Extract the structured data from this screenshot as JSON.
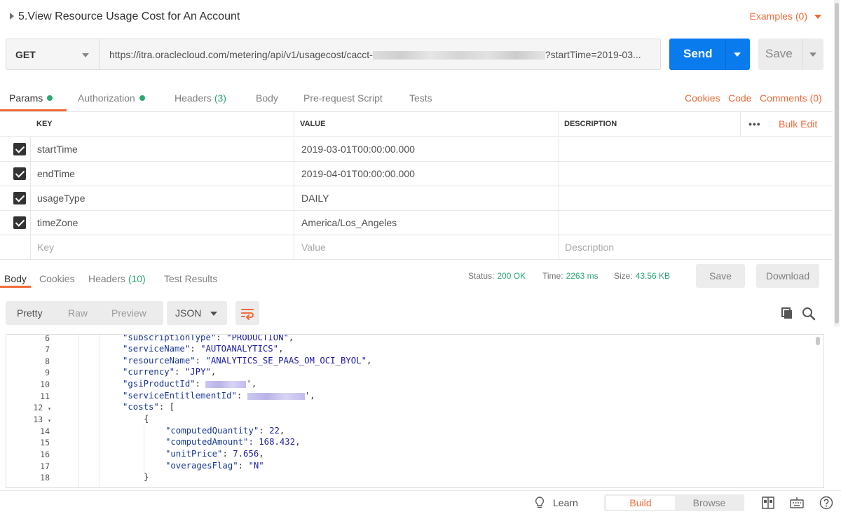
{
  "request": {
    "title": "5.View Resource Usage Cost for An Account",
    "examples_label": "Examples (0)",
    "method": "GET",
    "url_prefix": "https://itra.oraclecloud.com/metering/api/v1/usagecost/cacct-",
    "url_suffix": "?startTime=2019-03...",
    "send_label": "Send",
    "save_label": "Save"
  },
  "request_tabs": {
    "params": "Params",
    "authorization": "Authorization",
    "headers": "Headers",
    "headers_count": "(3)",
    "body": "Body",
    "pre_request": "Pre-request Script",
    "tests": "Tests",
    "cookies": "Cookies",
    "code": "Code",
    "comments": "Comments (0)"
  },
  "params_table": {
    "headers": [
      "KEY",
      "VALUE",
      "DESCRIPTION"
    ],
    "more": "•••",
    "bulk_edit": "Bulk Edit",
    "rows": [
      {
        "key": "startTime",
        "value": "2019-03-01T00:00:00.000",
        "description": ""
      },
      {
        "key": "endTime",
        "value": "2019-04-01T00:00:00.000",
        "description": ""
      },
      {
        "key": "usageType",
        "value": "DAILY",
        "description": ""
      },
      {
        "key": "timeZone",
        "value": "America/Los_Angeles",
        "description": ""
      }
    ],
    "placeholder": {
      "key": "Key",
      "value": "Value",
      "description": "Description"
    }
  },
  "response_tabs": {
    "body": "Body",
    "cookies": "Cookies",
    "headers": "Headers",
    "headers_count": "(10)",
    "test_results": "Test Results"
  },
  "response_status": {
    "status_label": "Status:",
    "status_value": "200 OK",
    "time_label": "Time:",
    "time_value": "2263 ms",
    "size_label": "Size:",
    "size_value": "43.56 KB",
    "save_label": "Save",
    "download_label": "Download"
  },
  "response_toolbar": {
    "pretty": "Pretty",
    "raw": "Raw",
    "preview": "Preview",
    "format": "JSON"
  },
  "code_lines": {
    "numbers": [
      "6",
      "7",
      "8",
      "9",
      "10",
      "11",
      "12",
      "13",
      "14",
      "15",
      "16",
      "17",
      "18"
    ],
    "l6_key": "\"subscriptionType\"",
    "l6_val": "\"PRODUCTION\"",
    "l7_key": "\"serviceName\"",
    "l7_val": "\"AUTOANALYTICS\"",
    "l8_key": "\"resourceName\"",
    "l8_val": "\"ANALYTICS_SE_PAAS_OM_OCI_BYOL\"",
    "l9_key": "\"currency\"",
    "l9_val": "\"JPY\"",
    "l10_key": "\"gsiProductId\"",
    "l11_key": "\"serviceEntitlementId\"",
    "l12_key": "\"costs\"",
    "l14_key": "\"computedQuantity\"",
    "l14_val": "22",
    "l15_key": "\"computedAmount\"",
    "l15_val": "168.432",
    "l16_key": "\"unitPrice\"",
    "l16_val": "7.656",
    "l17_key": "\"overagesFlag\"",
    "l17_val": "\"N\""
  },
  "footer": {
    "learn": "Learn",
    "build": "Build",
    "browse": "Browse"
  },
  "colors": {
    "accent": "#f26b3a",
    "send_blue": "#097bed",
    "success_green": "#2aa873"
  }
}
